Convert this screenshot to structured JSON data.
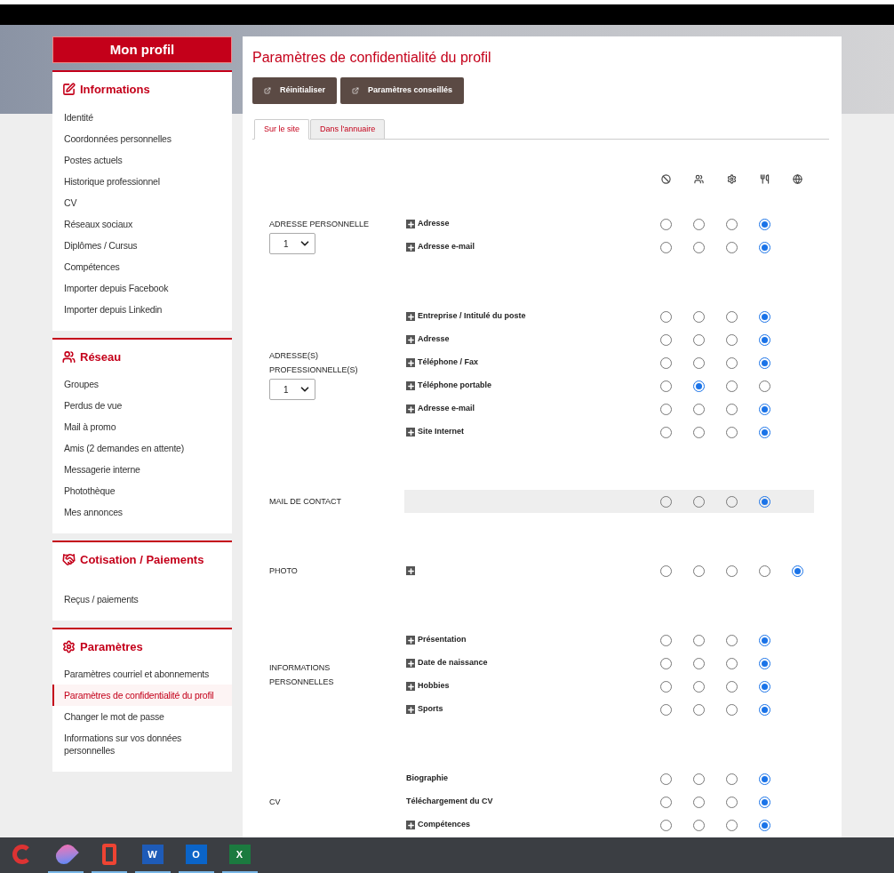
{
  "sidebar": {
    "title": "Mon profil",
    "sections": [
      {
        "kind": "edit",
        "title": "Informations",
        "items": [
          {
            "label": "Identité",
            "selected": false
          },
          {
            "label": "Coordonnées personnelles",
            "selected": false
          },
          {
            "label": "Postes actuels",
            "selected": false
          },
          {
            "label": "Historique professionnel",
            "selected": false
          },
          {
            "label": "CV",
            "selected": false
          },
          {
            "label": "Réseaux sociaux",
            "selected": false
          },
          {
            "label": "Diplômes / Cursus",
            "selected": false
          },
          {
            "label": "Compétences",
            "selected": false
          },
          {
            "label": "Importer depuis Facebook",
            "selected": false
          },
          {
            "label": "Importer depuis Linkedin",
            "selected": false
          }
        ]
      },
      {
        "kind": "users",
        "title": "Réseau",
        "items": [
          {
            "label": "Groupes",
            "selected": false
          },
          {
            "label": "Perdus de vue",
            "selected": false
          },
          {
            "label": "Mail à promo",
            "selected": false
          },
          {
            "label": "Amis (2 demandes en attente)",
            "selected": false
          },
          {
            "label": "Messagerie interne",
            "selected": false
          },
          {
            "label": "Photothèque",
            "selected": false
          },
          {
            "label": "Mes annonces",
            "selected": false
          }
        ]
      },
      {
        "kind": "handshake",
        "title": "Cotisation / Paiements",
        "items": [
          {
            "label": "Reçus / paiements",
            "selected": false
          }
        ]
      },
      {
        "kind": "gear",
        "title": "Paramètres",
        "items": [
          {
            "label": "Paramètres courriel et abonnements",
            "selected": false
          },
          {
            "label": "Paramètres de confidentialité du profil",
            "selected": true
          },
          {
            "label": "Changer le mot de passe",
            "selected": false
          },
          {
            "label": "Informations sur vos données personnelles",
            "selected": false
          }
        ]
      }
    ]
  },
  "main": {
    "title": "Paramètres de confidentialité du profil",
    "buttons": [
      "Réinitialiser",
      "Paramètres conseillés"
    ],
    "tabs": [
      {
        "label": "Sur le site",
        "selected": true
      },
      {
        "label": "Dans l'annuaire",
        "selected": false
      }
    ],
    "columns": [
      {
        "kind": "ban"
      },
      {
        "kind": "users"
      },
      {
        "kind": "gear"
      },
      {
        "kind": "utensils"
      },
      {
        "kind": "globe"
      }
    ],
    "groups": [
      {
        "label": "ADRESSE PERSONNELLE",
        "select": "1",
        "fields": [
          {
            "label": "Adresse",
            "expandable": true,
            "highlighted": false,
            "options": [
              false,
              false,
              false,
              true
            ]
          },
          {
            "label": "Adresse e-mail",
            "expandable": true,
            "highlighted": false,
            "options": [
              false,
              false,
              false,
              true
            ]
          }
        ]
      },
      {
        "label": "ADRESSE(S) PROFESSIONNELLE(S)",
        "select": "1",
        "fields": [
          {
            "label": "Entreprise / Intitulé du poste",
            "expandable": true,
            "highlighted": false,
            "options": [
              false,
              false,
              false,
              true
            ]
          },
          {
            "label": "Adresse",
            "expandable": true,
            "highlighted": false,
            "options": [
              false,
              false,
              false,
              true
            ]
          },
          {
            "label": "Téléphone / Fax",
            "expandable": true,
            "highlighted": false,
            "options": [
              false,
              false,
              false,
              true
            ]
          },
          {
            "label": "Téléphone portable",
            "expandable": true,
            "highlighted": false,
            "options": [
              false,
              true,
              false,
              false
            ]
          },
          {
            "label": "Adresse e-mail",
            "expandable": true,
            "highlighted": false,
            "options": [
              false,
              false,
              false,
              true
            ]
          },
          {
            "label": "Site Internet",
            "expandable": true,
            "highlighted": false,
            "options": [
              false,
              false,
              false,
              true
            ]
          }
        ]
      },
      {
        "label": "MAIL DE CONTACT",
        "fields": [
          {
            "expandable": false,
            "highlighted": true,
            "options": [
              false,
              false,
              false,
              true
            ]
          }
        ]
      },
      {
        "label": "PHOTO",
        "fields": [
          {
            "expandable": true,
            "highlighted": false,
            "options": [
              false,
              false,
              false,
              false,
              true
            ]
          }
        ]
      },
      {
        "label": "INFORMATIONS PERSONNELLES",
        "fields": [
          {
            "label": "Présentation",
            "expandable": true,
            "highlighted": false,
            "options": [
              false,
              false,
              false,
              true
            ]
          },
          {
            "label": "Date de naissance",
            "expandable": true,
            "highlighted": false,
            "options": [
              false,
              false,
              false,
              true
            ]
          },
          {
            "label": "Hobbies",
            "expandable": true,
            "highlighted": false,
            "options": [
              false,
              false,
              false,
              true
            ]
          },
          {
            "label": "Sports",
            "expandable": true,
            "highlighted": false,
            "options": [
              false,
              false,
              false,
              true
            ]
          }
        ]
      },
      {
        "label": "CV",
        "fields": [
          {
            "label": "Biographie",
            "expandable": false,
            "highlighted": false,
            "options": [
              false,
              false,
              false,
              true
            ]
          },
          {
            "label": "Téléchargement du CV",
            "expandable": false,
            "highlighted": false,
            "options": [
              false,
              false,
              false,
              true
            ]
          },
          {
            "label": "Compétences",
            "expandable": true,
            "highlighted": false,
            "options": [
              false,
              false,
              false,
              true
            ]
          }
        ]
      }
    ]
  },
  "taskbar": [
    {
      "kind": "brush",
      "running": false
    },
    {
      "kind": "drop",
      "running": true
    },
    {
      "kind": "office",
      "running": true
    },
    {
      "kind": "doc",
      "label": "W",
      "running": true
    },
    {
      "kind": "mail",
      "label": "O",
      "running": true
    },
    {
      "kind": "sheet",
      "label": "X",
      "running": true
    }
  ]
}
